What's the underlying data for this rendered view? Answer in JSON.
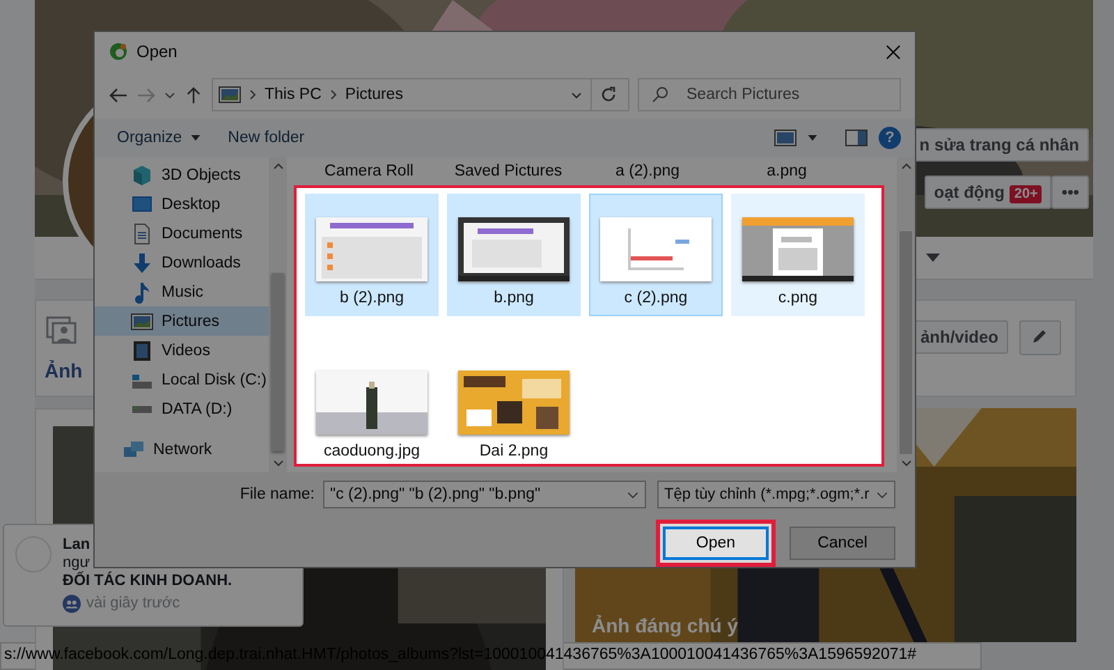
{
  "page": {
    "profile_buttons": [
      {
        "label": "n sửa trang cá nhân"
      },
      {
        "label": "oạt động",
        "badge": "20+"
      },
      {
        "label": "•••"
      }
    ],
    "photos_heading": "Ảnh",
    "post_button": "ảnh/video",
    "featured_caption": "Ảnh đáng chú ý",
    "notification": {
      "name": "Lan",
      "text": "ngư",
      "highlight": "ĐỐI TÁC KINH DOANH.",
      "time": "vài giây trước"
    }
  },
  "dialog": {
    "title": "Open",
    "breadcrumb": [
      "This PC",
      "Pictures"
    ],
    "search": {
      "placeholder": "Search Pictures"
    },
    "toolbar": [
      "Organize",
      "New folder"
    ],
    "help": "?",
    "nav": {
      "this_pc": [
        {
          "label": "3D Objects",
          "selected": false
        },
        {
          "label": "Desktop",
          "selected": false
        },
        {
          "label": "Documents",
          "selected": false
        },
        {
          "label": "Downloads",
          "selected": false
        },
        {
          "label": "Music",
          "selected": false
        },
        {
          "label": "Pictures",
          "selected": true
        },
        {
          "label": "Videos",
          "selected": false
        },
        {
          "label": "Local Disk (C:)",
          "selected": false
        },
        {
          "label": "DATA (D:)",
          "selected": false
        }
      ],
      "network": {
        "label": "Network",
        "selected": false
      }
    },
    "folders_partial": [
      "Camera Roll",
      "Saved Pictures",
      "a (2).png",
      "a.png"
    ],
    "files": [
      {
        "name": "b (2).png",
        "selected": true,
        "focused": false,
        "hovered": false
      },
      {
        "name": "b.png",
        "selected": true,
        "focused": false,
        "hovered": false
      },
      {
        "name": "c (2).png",
        "selected": true,
        "focused": true,
        "hovered": false
      },
      {
        "name": "c.png",
        "selected": false,
        "focused": false,
        "hovered": true
      },
      {
        "name": "caoduong.jpg",
        "selected": false,
        "focused": false,
        "hovered": false
      },
      {
        "name": "Dai 2.png",
        "selected": false,
        "focused": false,
        "hovered": false
      }
    ],
    "file_name_label": "File name:",
    "file_name": "\"c (2).png\" \"b (2).png\" \"b.png\"",
    "file_type": "Tệp tùy chỉnh (*.mpg;*.ogm;*.r",
    "buttons": [
      {
        "label": "Open",
        "kind": "default"
      },
      {
        "label": "Cancel",
        "kind": "normal"
      }
    ]
  },
  "status_bar": "s://www.facebook.com/Long.dep.trai.nhat.HMT/photos_albums?lst=100010041436765%3A100010041436765%3A1596592071#"
}
